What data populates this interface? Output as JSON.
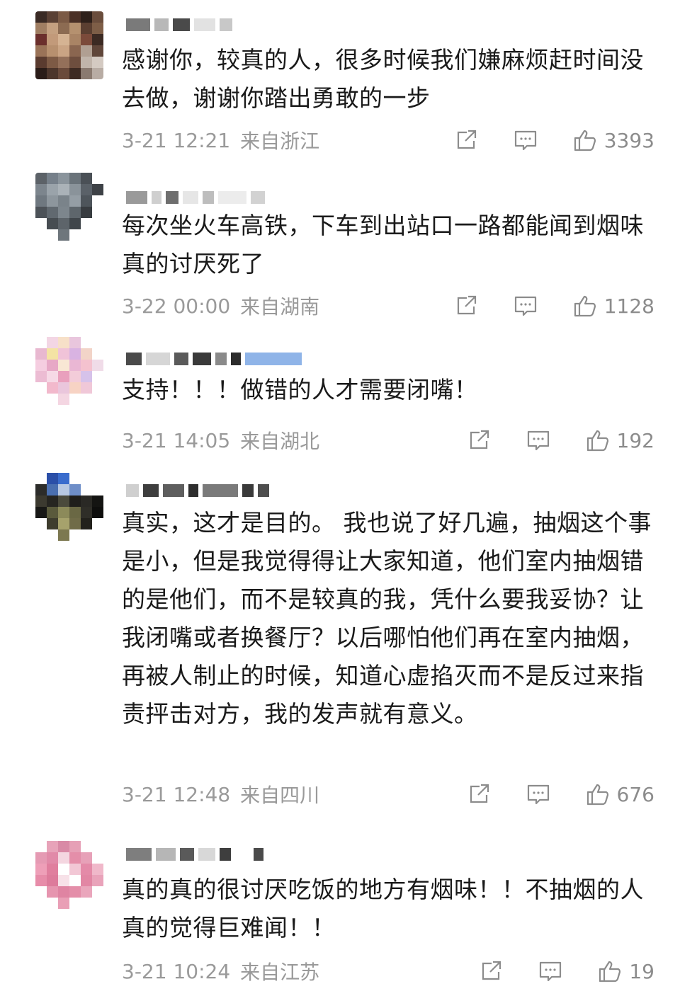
{
  "comments": [
    {
      "text": "感谢你，较真的人，很多时候我们嫌麻烦赶时间没去做，谢谢你踏出勇敢的一步",
      "time": "3-21 12:21",
      "location": "来自浙江",
      "likes": "3393"
    },
    {
      "text": "每次坐火车高铁，下车到出站口一路都能闻到烟味真的讨厌死了",
      "time": "3-22 00:00",
      "location": "来自湖南",
      "likes": "1128"
    },
    {
      "text": "支持！！！做错的人才需要闭嘴！",
      "time": "3-21 14:05",
      "location": "来自湖北",
      "likes": "192"
    },
    {
      "text": "真实，这才是目的。 我也说了好几遍，抽烟这个事是小，但是我觉得得让大家知道，他们室内抽烟错的是他们，而不是较真的我，凭什么要我妥协？让我闭嘴或者换餐厅？以后哪怕他们再在室内抽烟，再被人制止的时候，知道心虚掐灭而不是反过来指责抨击对方，我的发声就有意义。",
      "time": "3-21 12:48",
      "location": "来自四川",
      "likes": "676"
    },
    {
      "text": "真的真的很讨厌吃饭的地方有烟味！！不抽烟的人真的觉得巨难闻！！",
      "time": "3-21 10:24",
      "location": "来自江苏",
      "likes": "19"
    }
  ],
  "icons": {
    "share": "share-icon",
    "comment": "comment-icon",
    "like": "thumbs-up-icon"
  },
  "colors": {
    "text": "#1a1a1a",
    "meta": "#9a9a9a",
    "icon": "#8c8c8c"
  }
}
